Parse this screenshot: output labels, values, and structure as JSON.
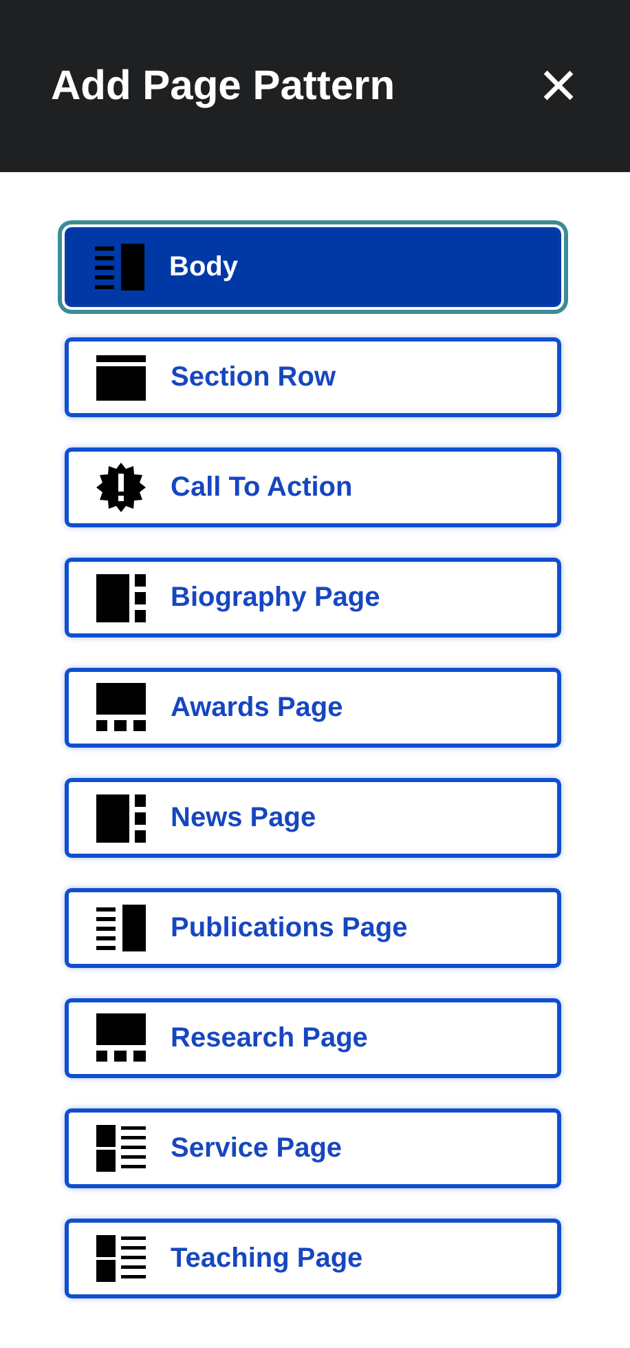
{
  "header": {
    "title": "Add Page Pattern",
    "close": "×"
  },
  "patterns": [
    {
      "label": "Body",
      "kind": "body",
      "selected": true
    },
    {
      "label": "Section Row",
      "kind": "section",
      "selected": false
    },
    {
      "label": "Call To Action",
      "kind": "alert",
      "selected": false
    },
    {
      "label": "Biography Page",
      "kind": "sidebar",
      "selected": false
    },
    {
      "label": "Awards Page",
      "kind": "grid",
      "selected": false
    },
    {
      "label": "News Page",
      "kind": "sidebar",
      "selected": false
    },
    {
      "label": "Publications Page",
      "kind": "body",
      "selected": false
    },
    {
      "label": "Research Page",
      "kind": "grid",
      "selected": false
    },
    {
      "label": "Service Page",
      "kind": "list",
      "selected": false
    },
    {
      "label": "Teaching Page",
      "kind": "list",
      "selected": false
    }
  ]
}
